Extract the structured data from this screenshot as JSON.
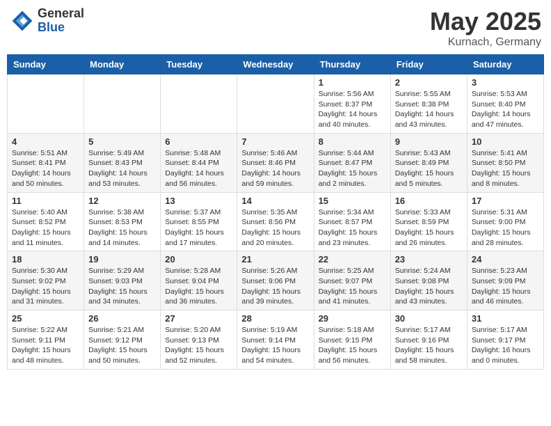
{
  "header": {
    "logo_general": "General",
    "logo_blue": "Blue",
    "month": "May 2025",
    "location": "Kurnach, Germany"
  },
  "weekdays": [
    "Sunday",
    "Monday",
    "Tuesday",
    "Wednesday",
    "Thursday",
    "Friday",
    "Saturday"
  ],
  "weeks": [
    [
      {
        "day": "",
        "info": ""
      },
      {
        "day": "",
        "info": ""
      },
      {
        "day": "",
        "info": ""
      },
      {
        "day": "",
        "info": ""
      },
      {
        "day": "1",
        "info": "Sunrise: 5:56 AM\nSunset: 8:37 PM\nDaylight: 14 hours\nand 40 minutes."
      },
      {
        "day": "2",
        "info": "Sunrise: 5:55 AM\nSunset: 8:38 PM\nDaylight: 14 hours\nand 43 minutes."
      },
      {
        "day": "3",
        "info": "Sunrise: 5:53 AM\nSunset: 8:40 PM\nDaylight: 14 hours\nand 47 minutes."
      }
    ],
    [
      {
        "day": "4",
        "info": "Sunrise: 5:51 AM\nSunset: 8:41 PM\nDaylight: 14 hours\nand 50 minutes."
      },
      {
        "day": "5",
        "info": "Sunrise: 5:49 AM\nSunset: 8:43 PM\nDaylight: 14 hours\nand 53 minutes."
      },
      {
        "day": "6",
        "info": "Sunrise: 5:48 AM\nSunset: 8:44 PM\nDaylight: 14 hours\nand 56 minutes."
      },
      {
        "day": "7",
        "info": "Sunrise: 5:46 AM\nSunset: 8:46 PM\nDaylight: 14 hours\nand 59 minutes."
      },
      {
        "day": "8",
        "info": "Sunrise: 5:44 AM\nSunset: 8:47 PM\nDaylight: 15 hours\nand 2 minutes."
      },
      {
        "day": "9",
        "info": "Sunrise: 5:43 AM\nSunset: 8:49 PM\nDaylight: 15 hours\nand 5 minutes."
      },
      {
        "day": "10",
        "info": "Sunrise: 5:41 AM\nSunset: 8:50 PM\nDaylight: 15 hours\nand 8 minutes."
      }
    ],
    [
      {
        "day": "11",
        "info": "Sunrise: 5:40 AM\nSunset: 8:52 PM\nDaylight: 15 hours\nand 11 minutes."
      },
      {
        "day": "12",
        "info": "Sunrise: 5:38 AM\nSunset: 8:53 PM\nDaylight: 15 hours\nand 14 minutes."
      },
      {
        "day": "13",
        "info": "Sunrise: 5:37 AM\nSunset: 8:55 PM\nDaylight: 15 hours\nand 17 minutes."
      },
      {
        "day": "14",
        "info": "Sunrise: 5:35 AM\nSunset: 8:56 PM\nDaylight: 15 hours\nand 20 minutes."
      },
      {
        "day": "15",
        "info": "Sunrise: 5:34 AM\nSunset: 8:57 PM\nDaylight: 15 hours\nand 23 minutes."
      },
      {
        "day": "16",
        "info": "Sunrise: 5:33 AM\nSunset: 8:59 PM\nDaylight: 15 hours\nand 26 minutes."
      },
      {
        "day": "17",
        "info": "Sunrise: 5:31 AM\nSunset: 9:00 PM\nDaylight: 15 hours\nand 28 minutes."
      }
    ],
    [
      {
        "day": "18",
        "info": "Sunrise: 5:30 AM\nSunset: 9:02 PM\nDaylight: 15 hours\nand 31 minutes."
      },
      {
        "day": "19",
        "info": "Sunrise: 5:29 AM\nSunset: 9:03 PM\nDaylight: 15 hours\nand 34 minutes."
      },
      {
        "day": "20",
        "info": "Sunrise: 5:28 AM\nSunset: 9:04 PM\nDaylight: 15 hours\nand 36 minutes."
      },
      {
        "day": "21",
        "info": "Sunrise: 5:26 AM\nSunset: 9:06 PM\nDaylight: 15 hours\nand 39 minutes."
      },
      {
        "day": "22",
        "info": "Sunrise: 5:25 AM\nSunset: 9:07 PM\nDaylight: 15 hours\nand 41 minutes."
      },
      {
        "day": "23",
        "info": "Sunrise: 5:24 AM\nSunset: 9:08 PM\nDaylight: 15 hours\nand 43 minutes."
      },
      {
        "day": "24",
        "info": "Sunrise: 5:23 AM\nSunset: 9:09 PM\nDaylight: 15 hours\nand 46 minutes."
      }
    ],
    [
      {
        "day": "25",
        "info": "Sunrise: 5:22 AM\nSunset: 9:11 PM\nDaylight: 15 hours\nand 48 minutes."
      },
      {
        "day": "26",
        "info": "Sunrise: 5:21 AM\nSunset: 9:12 PM\nDaylight: 15 hours\nand 50 minutes."
      },
      {
        "day": "27",
        "info": "Sunrise: 5:20 AM\nSunset: 9:13 PM\nDaylight: 15 hours\nand 52 minutes."
      },
      {
        "day": "28",
        "info": "Sunrise: 5:19 AM\nSunset: 9:14 PM\nDaylight: 15 hours\nand 54 minutes."
      },
      {
        "day": "29",
        "info": "Sunrise: 5:18 AM\nSunset: 9:15 PM\nDaylight: 15 hours\nand 56 minutes."
      },
      {
        "day": "30",
        "info": "Sunrise: 5:17 AM\nSunset: 9:16 PM\nDaylight: 15 hours\nand 58 minutes."
      },
      {
        "day": "31",
        "info": "Sunrise: 5:17 AM\nSunset: 9:17 PM\nDaylight: 16 hours\nand 0 minutes."
      }
    ]
  ]
}
